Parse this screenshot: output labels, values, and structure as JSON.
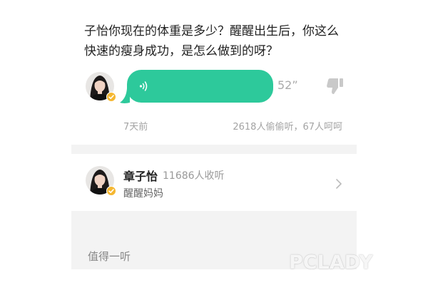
{
  "question": {
    "text": "子怡你现在的体重是多少？醒醒出生后，你这么快速的瘦身成功，是怎么做到的呀？"
  },
  "answer": {
    "duration": "52”",
    "time_ago": "7天前",
    "stats": "2618人偷偷听，67人呵呵",
    "bubble_color": "#2dc99b",
    "sound_icon": "sound-wave-icon",
    "dislike_icon": "thumb-down-icon"
  },
  "author": {
    "name": "章子怡",
    "listens": "11686人收听",
    "subtitle": "醒醒妈妈",
    "verified_color": "#f5b731",
    "chevron_icon": "chevron-right-icon"
  },
  "section": {
    "title": "值得一听"
  },
  "watermark": {
    "text": "PCLADY"
  }
}
